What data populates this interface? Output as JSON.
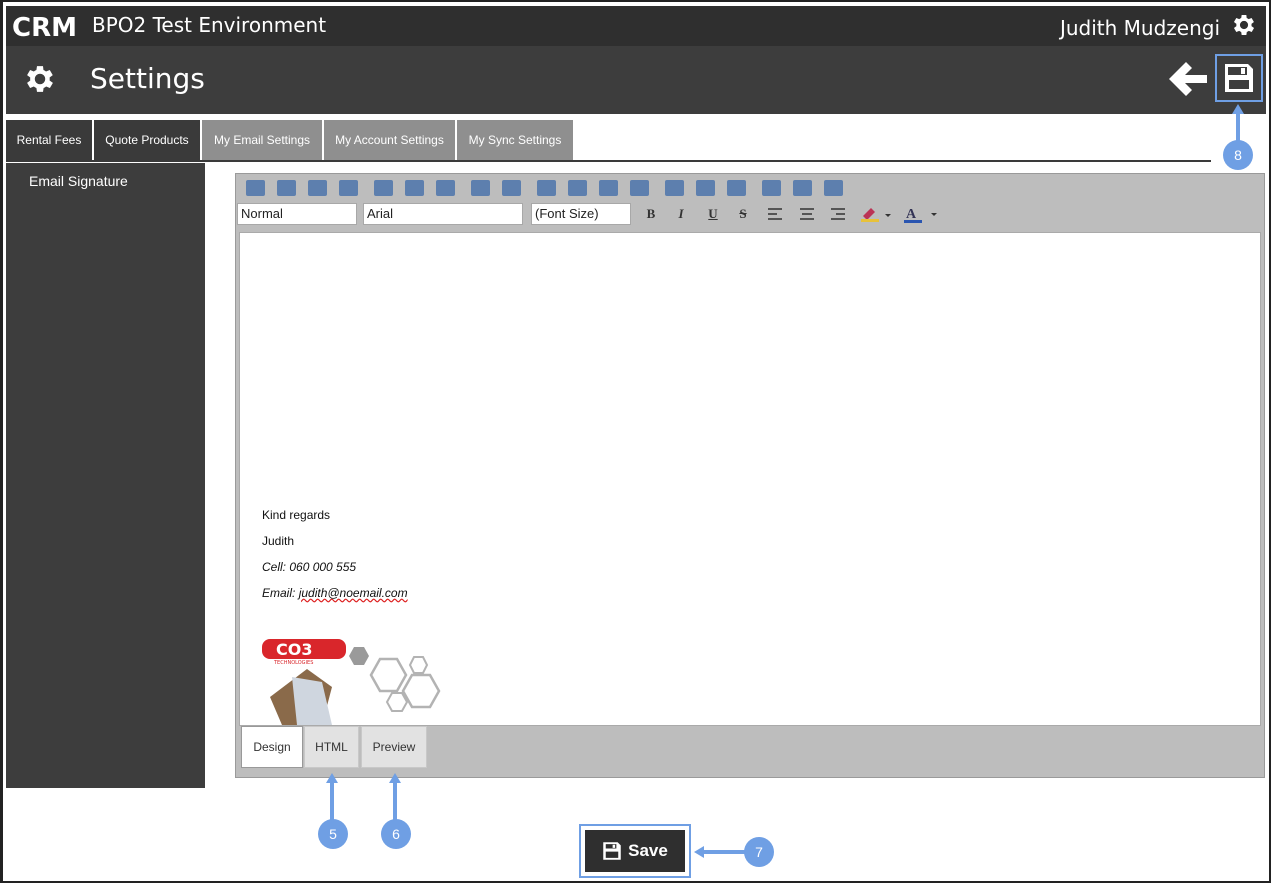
{
  "header": {
    "logo_text": "CRM",
    "app_title": "BPO2 Test Environment",
    "user_name": "Judith Mudzengi"
  },
  "titlebar": {
    "page_title": "Settings"
  },
  "tabs": [
    {
      "label": "Rental Fees",
      "style": "dark"
    },
    {
      "label": "Quote Products",
      "style": "dark"
    },
    {
      "label": "My Email Settings",
      "style": "light"
    },
    {
      "label": "My Account Settings",
      "style": "light"
    },
    {
      "label": "My Sync Settings",
      "style": "light"
    }
  ],
  "sidebar": {
    "items": [
      {
        "label": "Email Signature"
      }
    ]
  },
  "editor": {
    "paragraph_style": "Normal",
    "font_family": "Arial",
    "font_size": "(Font Size)",
    "format_buttons": {
      "bold": "B",
      "italic": "I",
      "underline": "U",
      "strike": "S"
    },
    "signature": {
      "line1": "Kind regards",
      "line2": "Judith",
      "line3": "Cell: 060 000 555",
      "line4_prefix": "Email: ",
      "line4_email": "judith@noemail.com",
      "logo_text": "CO3",
      "logo_subtext": "TECHNOLOGIES"
    },
    "modes": [
      {
        "label": "Design",
        "active": true
      },
      {
        "label": "HTML",
        "active": false
      },
      {
        "label": "Preview",
        "active": false
      }
    ]
  },
  "save_button": {
    "label": "Save"
  },
  "callouts": {
    "c5": "5",
    "c6": "6",
    "c7": "7",
    "c8": "8"
  },
  "colors": {
    "header_bg": "#2f2f2f",
    "titlebar_bg": "#3d3d3d",
    "accent_callout": "#6f9fe4",
    "toolbar_icon": "#5d7fae"
  }
}
